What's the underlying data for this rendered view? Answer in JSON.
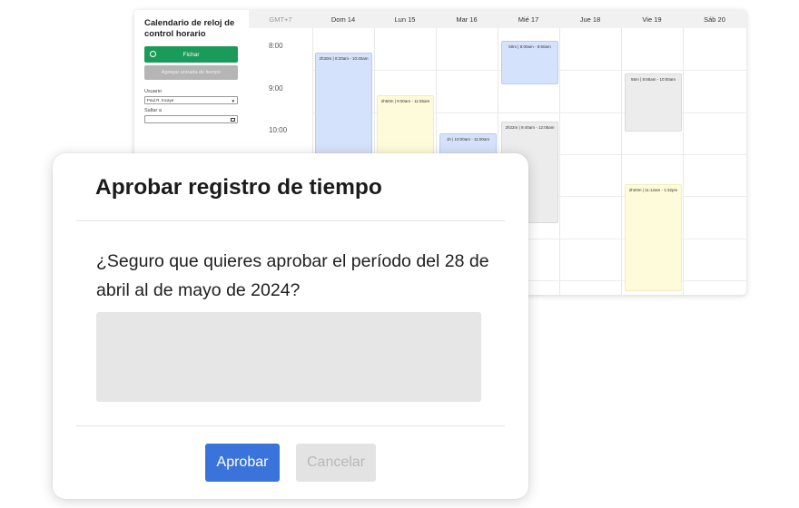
{
  "sidebar": {
    "title": "Calendario de reloj de control horario",
    "fichar_label": "Fichar",
    "agregar_label": "Agregar entrada de tiempo",
    "usuario_label": "Usuario",
    "usuario_value": "Paul R. Incaye",
    "saltar_label": "Saltar a"
  },
  "calendar": {
    "timezone": "GMT+7",
    "days": [
      "Dom 14",
      "Lun 15",
      "Mar 16",
      "Mié 17",
      "Jue 18",
      "Vie 19",
      "Sáb 20"
    ],
    "hours": [
      "8:00",
      "9:00",
      "10:00"
    ],
    "events": [
      {
        "text": "2h30m | 8:20am - 10:40am",
        "color": "blue"
      },
      {
        "text": "2h50m | 9:00am - 11:55am",
        "color": "yellow"
      },
      {
        "text": "1h | 10:00am - 11:00am",
        "color": "blue"
      },
      {
        "text": "50m | 8:00am - 8:50am",
        "color": "blue"
      },
      {
        "text": "2h22m | 9:40am - 12:05am",
        "color": "gray"
      },
      {
        "text": "55m | 8:65am - 10:00am",
        "color": "gray"
      },
      {
        "text": "2h20m | 11:12am - 1:32pm",
        "color": "yellow"
      }
    ]
  },
  "modal": {
    "title": "Aprobar registro de tiempo",
    "message": "¿Seguro que quieres aprobar el período del 28 de abril al de mayo de 2024?",
    "approve_label": "Aprobar",
    "cancel_label": "Cancelar"
  },
  "colors": {
    "fichar_green": "#1b9b5a",
    "approve_blue": "#3a73d9",
    "event_blue": "#d5e2fb",
    "event_yellow": "#fdfbd9",
    "event_gray": "#ececec"
  }
}
